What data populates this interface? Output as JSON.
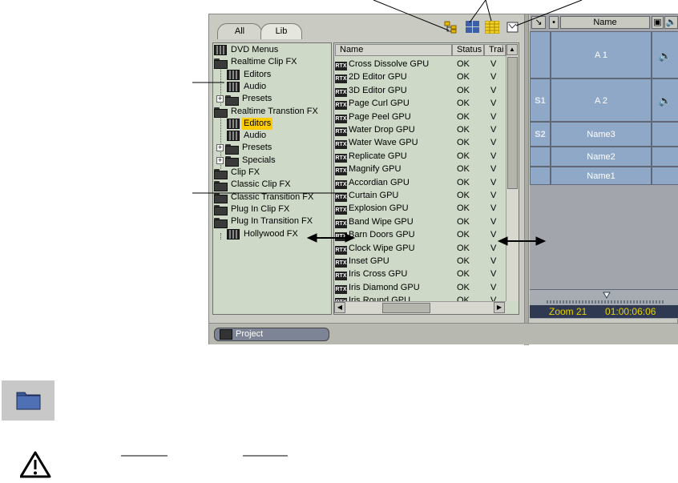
{
  "tabs": [
    "All",
    "Lib"
  ],
  "tree": [
    {
      "label": "DVD Menus",
      "icon": "film-icon",
      "indent": 0
    },
    {
      "label": "Realtime Clip FX",
      "icon": "folder-icon",
      "indent": 0
    },
    {
      "label": "Editors",
      "icon": "film-icon",
      "indent": 1
    },
    {
      "label": "Audio",
      "icon": "film-icon",
      "indent": 1
    },
    {
      "label": "Presets",
      "icon": "folder-icon",
      "indent": 1,
      "expander": "+"
    },
    {
      "label": "Realtime Transtion FX",
      "icon": "folder-icon",
      "indent": 0
    },
    {
      "label": "Editors",
      "icon": "film-icon",
      "indent": 1,
      "selected": true
    },
    {
      "label": "Audio",
      "icon": "film-icon",
      "indent": 1
    },
    {
      "label": "Presets",
      "icon": "folder-icon",
      "indent": 1,
      "expander": "+"
    },
    {
      "label": "Specials",
      "icon": "folder-icon",
      "indent": 1,
      "expander": "+"
    },
    {
      "label": "Clip FX",
      "icon": "folder-icon",
      "indent": 0
    },
    {
      "label": "Classic Clip FX",
      "icon": "folder-icon",
      "indent": 0
    },
    {
      "label": "Classic Transition FX",
      "icon": "folder-icon",
      "indent": 0
    },
    {
      "label": "Plug In Clip FX",
      "icon": "folder-icon",
      "indent": 0
    },
    {
      "label": "Plug In Transition FX",
      "icon": "folder-icon",
      "indent": 0
    },
    {
      "label": "Hollywood FX",
      "icon": "film-icon",
      "indent": 1
    }
  ],
  "list": {
    "headers": [
      "Name",
      "Status",
      "Trai"
    ],
    "badge": "RTX",
    "rows": [
      [
        "Cross Dissolve GPU",
        "OK",
        "V"
      ],
      [
        "2D Editor GPU",
        "OK",
        "V"
      ],
      [
        "3D Editor GPU",
        "OK",
        "V"
      ],
      [
        "Page Curl GPU",
        "OK",
        "V"
      ],
      [
        "Page Peel GPU",
        "OK",
        "V"
      ],
      [
        "Water Drop GPU",
        "OK",
        "V"
      ],
      [
        "Water Wave GPU",
        "OK",
        "V"
      ],
      [
        "Replicate GPU",
        "OK",
        "V"
      ],
      [
        "Magnify GPU",
        "OK",
        "V"
      ],
      [
        "Accordian GPU",
        "OK",
        "V"
      ],
      [
        "Curtain GPU",
        "OK",
        "V"
      ],
      [
        "Explosion GPU",
        "OK",
        "V"
      ],
      [
        "Band Wipe GPU",
        "OK",
        "V"
      ],
      [
        "Barn Doors GPU",
        "OK",
        "V"
      ],
      [
        "Clock Wipe GPU",
        "OK",
        "V"
      ],
      [
        "Inset GPU",
        "OK",
        "V"
      ],
      [
        "Iris Cross GPU",
        "OK",
        "V"
      ],
      [
        "Iris Diamond GPU",
        "OK",
        "V"
      ],
      [
        "Iris Round GPU",
        "OK",
        "V"
      ]
    ]
  },
  "timeline": {
    "header_name": "Name",
    "tracks": [
      {
        "side": "",
        "name": "A 1",
        "vol": "🔈"
      },
      {
        "side": "S1",
        "name": "A 2",
        "vol": "🔈"
      },
      {
        "side": "S2",
        "name": "Name3",
        "vol": ""
      },
      {
        "side": "",
        "name": "Name2",
        "vol": ""
      },
      {
        "side": "",
        "name": "Name1",
        "vol": ""
      }
    ],
    "zoom": "Zoom 21",
    "timecode": "01:00:06:06"
  },
  "project_button": "Project",
  "colors": {
    "selection": "#ffcc00",
    "track": "#90a8c8",
    "zoom_text": "#e8d200"
  }
}
